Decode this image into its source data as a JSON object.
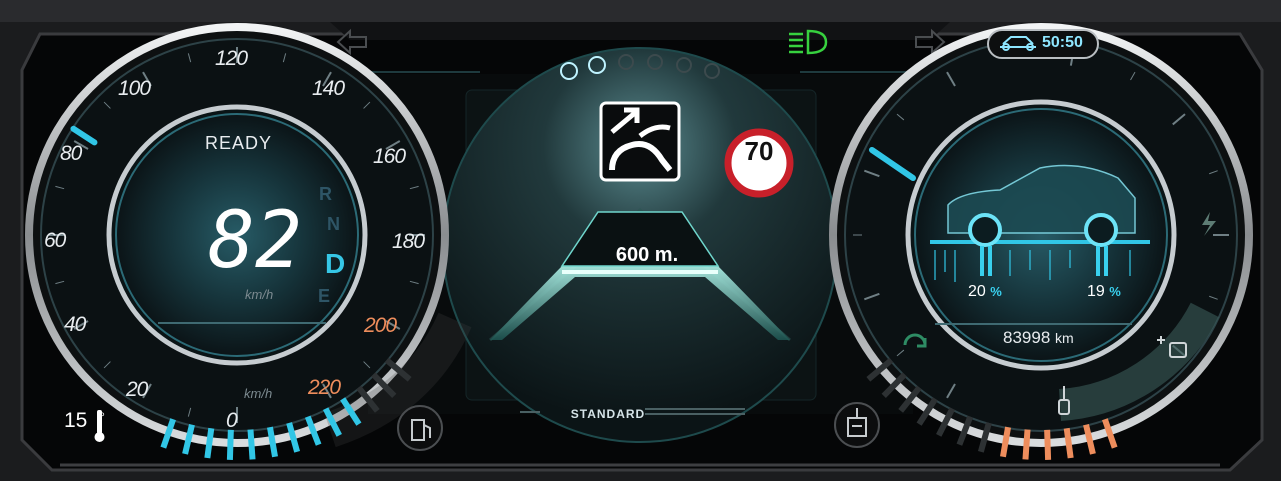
{
  "colors": {
    "accent": "#31c6e6",
    "warning": "#ee8d5c",
    "limit_ring": "#c8202a",
    "light_icon": "#37d13f",
    "frame": "#2b2c2f"
  },
  "icons": [
    "arrow-left-icon",
    "headlight-icon",
    "arrow-right-icon",
    "snowflake-icon",
    "road-turn-icon",
    "fuel-pump-icon",
    "car-icon",
    "battery-icon",
    "battery-plus-icon",
    "thermometer-icon",
    "lightning-icon",
    "regen-icon",
    "coolant-icon"
  ],
  "speedometer": {
    "status": "READY",
    "speed": "82",
    "unit": "km/h",
    "gears": [
      "R",
      "N",
      "D",
      "E"
    ],
    "active_gear": "D",
    "scale": [
      "0",
      "20",
      "40",
      "60",
      "80",
      "100",
      "120",
      "140",
      "160",
      "180",
      "200",
      "220"
    ],
    "scale_unit": "km/h",
    "needle_value": 82,
    "range": [
      0,
      220
    ]
  },
  "temperature": {
    "value": "15",
    "unit": "°"
  },
  "center": {
    "distance": "600 m.",
    "speed_limit": "70",
    "mode": "STANDARD",
    "snowflakes_active": 2,
    "snowflakes_total": 6
  },
  "right_gauge": {
    "time": "50:50",
    "tire_front": {
      "value": "20",
      "unit": "%"
    },
    "tire_rear": {
      "value": "19",
      "unit": "%"
    },
    "odometer": "83998",
    "odometer_unit": "km"
  },
  "fuel_bar_level": 0.75,
  "battery_temp_level": 0.45
}
